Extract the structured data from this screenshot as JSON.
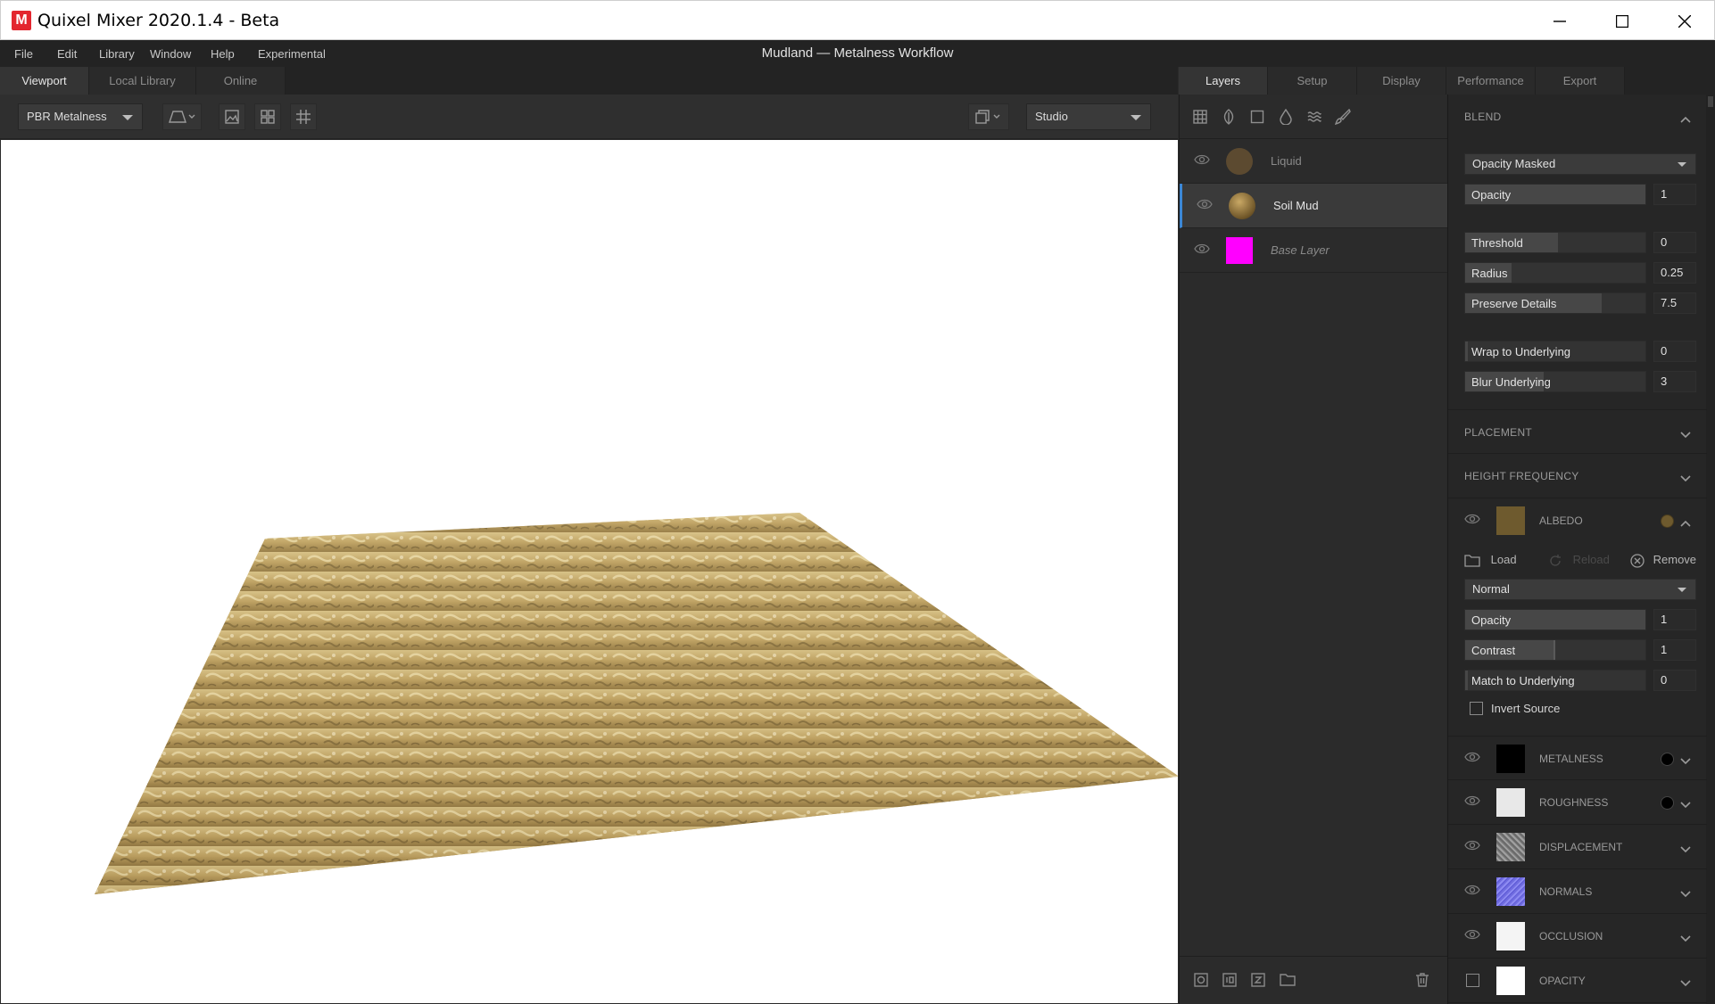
{
  "window": {
    "title": "Quixel Mixer 2020.1.4 - Beta",
    "logo_letter": "M",
    "document_title": "Mudland — Metalness Workflow"
  },
  "menu": [
    "File",
    "Edit",
    "Library",
    "Window",
    "Help",
    "Experimental"
  ],
  "left_tabs": [
    "Viewport",
    "Local Library",
    "Online"
  ],
  "right_tabs": [
    "Layers",
    "Setup",
    "Display",
    "Performance",
    "Export"
  ],
  "viewport_toolbar": {
    "shading_mode": "PBR Metalness",
    "environment": "Studio"
  },
  "layers": [
    {
      "name": "Liquid",
      "thumb_color": "#5c4a30",
      "selected": false,
      "italic": false
    },
    {
      "name": "Soil Mud",
      "thumb_color": "#8a7040",
      "selected": true,
      "italic": false
    },
    {
      "name": "Base Layer",
      "thumb_color": "#ff00ff",
      "selected": false,
      "italic": true
    }
  ],
  "blend": {
    "title": "BLEND",
    "mode": "Opacity Masked",
    "opacity_label": "Opacity",
    "opacity": "1",
    "threshold_label": "Threshold",
    "threshold": "0",
    "radius_label": "Radius",
    "radius": "0.25",
    "preserve_label": "Preserve Details",
    "preserve": "7.5",
    "wrap_label": "Wrap to Underlying",
    "wrap": "0",
    "blur_label": "Blur Underlying",
    "blur": "3"
  },
  "sections": {
    "placement": "PLACEMENT",
    "height_frequency": "HEIGHT FREQUENCY"
  },
  "albedo": {
    "title": "ALBEDO",
    "swatch": "#6e5a2e",
    "load": "Load",
    "reload": "Reload",
    "remove": "Remove",
    "blend_mode": "Normal",
    "opacity_label": "Opacity",
    "opacity": "1",
    "contrast_label": "Contrast",
    "contrast": "1",
    "match_label": "Match to Underlying",
    "match": "0",
    "invert_label": "Invert Source"
  },
  "channels": [
    {
      "name": "METALNESS",
      "swatch": "#000000",
      "dot": true
    },
    {
      "name": "ROUGHNESS",
      "swatch": "#e8e8e8",
      "dot": true
    },
    {
      "name": "DISPLACEMENT",
      "swatch": "#8a8a8a",
      "dot": false
    },
    {
      "name": "NORMALS",
      "swatch": "#7b78e8",
      "dot": false
    },
    {
      "name": "OCCLUSION",
      "swatch": "#f4f4f4",
      "dot": false
    },
    {
      "name": "OPACITY",
      "swatch": "#ffffff",
      "dot": false
    }
  ]
}
